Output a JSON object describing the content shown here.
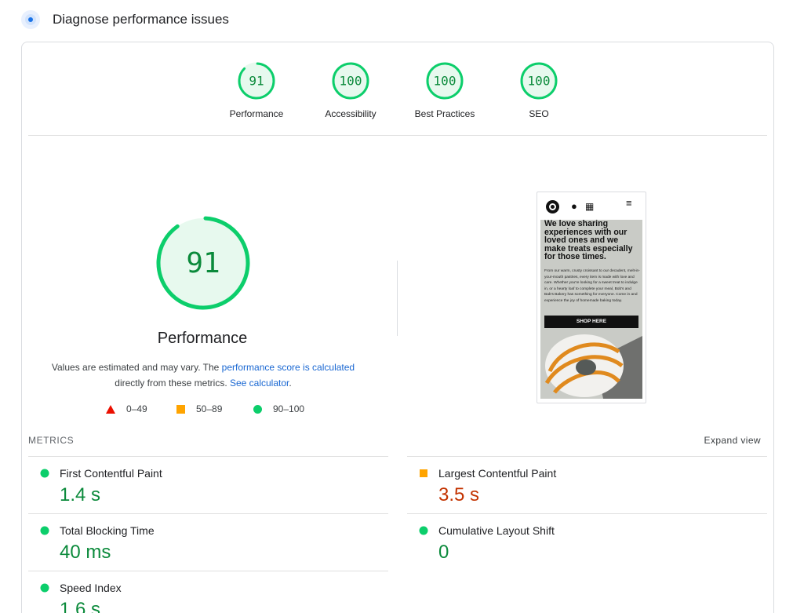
{
  "header": {
    "title": "Diagnose performance issues",
    "icon": "diagnose-icon"
  },
  "colors": {
    "pass": "#0cce6b",
    "pass_text": "#0b8a3b",
    "average": "#ffa400",
    "average_text": "#c33300",
    "fail": "#eb0f00",
    "link": "#1967d2"
  },
  "categories": [
    {
      "score": "91",
      "label": "Performance",
      "value": 91
    },
    {
      "score": "100",
      "label": "Accessibility",
      "value": 100
    },
    {
      "score": "100",
      "label": "Best Practices",
      "value": 100
    },
    {
      "score": "100",
      "label": "SEO",
      "value": 100
    }
  ],
  "performance": {
    "score": "91",
    "value": 91,
    "title": "Performance",
    "desc_prefix": "Values are estimated and may vary. The ",
    "desc_link": "performance score is calculated",
    "desc_mid": " directly from these metrics. ",
    "desc_calc": "See calculator",
    "desc_end": "."
  },
  "legend": {
    "fail": "0–49",
    "average": "50–89",
    "pass": "90–100"
  },
  "screenshot": {
    "icons": [
      "logo-icon",
      "user-icon",
      "basket-icon",
      "menu-icon"
    ],
    "headline": "We love sharing experiences with our loved ones and we make treats especially for those times.",
    "body": "From our warm, crusty croissant to our decadent, melt-in-your-mouth pastries, every item is made with love and care. Whether you're looking for a sweet treat to indulge in, or a hearty loaf to complete your meal, Bob's and Bab's Bakery has something for everyone. Come in and experience the joy of homemade baking today.",
    "button": "SHOP HERE"
  },
  "metrics": {
    "heading": "METRICS",
    "expand": "Expand view",
    "fcp": {
      "name": "First Contentful Paint",
      "value": "1.4 s",
      "status": "pass"
    },
    "lcp": {
      "name": "Largest Contentful Paint",
      "value": "3.5 s",
      "status": "average"
    },
    "tbt": {
      "name": "Total Blocking Time",
      "value": "40 ms",
      "status": "pass"
    },
    "cls": {
      "name": "Cumulative Layout Shift",
      "value": "0",
      "status": "pass"
    },
    "si": {
      "name": "Speed Index",
      "value": "1.6 s",
      "status": "pass"
    }
  }
}
